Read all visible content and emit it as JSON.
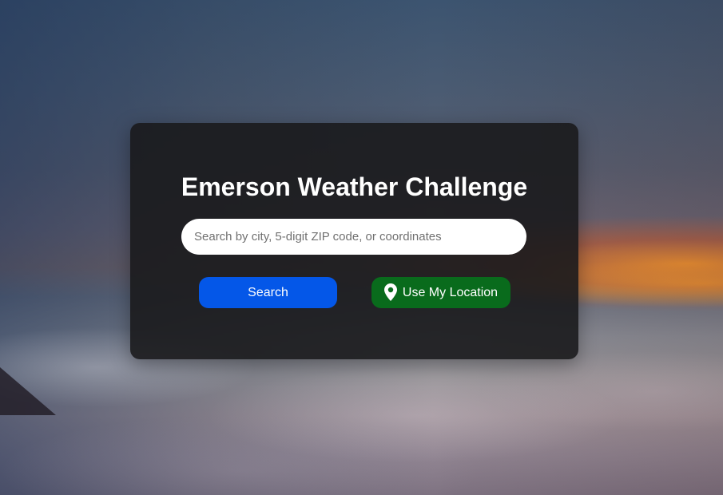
{
  "app": {
    "title": "Emerson Weather Challenge"
  },
  "search": {
    "placeholder": "Search by city, 5-digit ZIP code, or coordinates",
    "value": ""
  },
  "buttons": {
    "search_label": "Search",
    "location_label": "Use My Location",
    "location_icon": "map-pin-icon"
  },
  "colors": {
    "search_button": "#0457e8",
    "location_button": "#096b1c",
    "card_background": "#19191c"
  }
}
